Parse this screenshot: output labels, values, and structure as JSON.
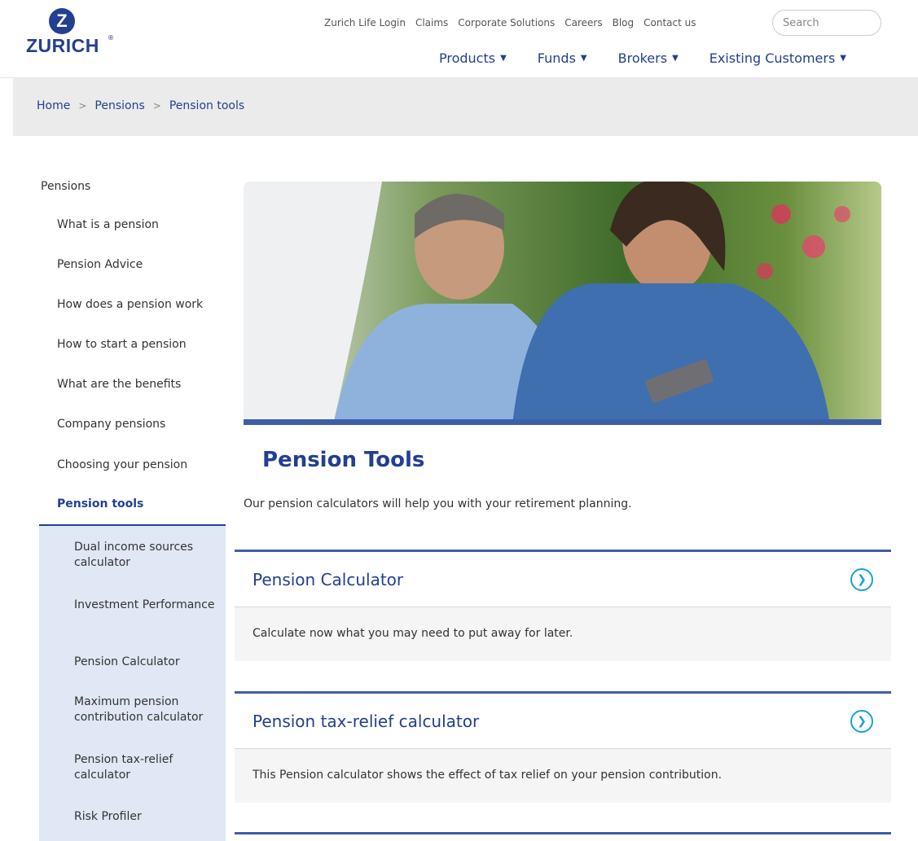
{
  "brand": {
    "logo_mark": "Z",
    "name": "ZURICH",
    "registered": "®"
  },
  "utility_nav": [
    "Zurich Life Login",
    "Claims",
    "Corporate Solutions",
    "Careers",
    "Blog",
    "Contact us"
  ],
  "search": {
    "placeholder": "Search"
  },
  "main_nav": [
    {
      "label": "Products"
    },
    {
      "label": "Funds"
    },
    {
      "label": "Brokers"
    },
    {
      "label": "Existing Customers"
    }
  ],
  "breadcrumb": [
    "Home",
    "Pensions",
    "Pension tools"
  ],
  "breadcrumb_separator": ">",
  "sidebar": {
    "root": "Pensions",
    "items": [
      "What is a pension",
      "Pension Advice",
      "How does a pension work",
      "How to start a pension",
      "What are the benefits",
      "Company pensions",
      "Choosing your pension"
    ],
    "active": "Pension tools",
    "sub_items": [
      "Dual income sources calculator",
      "Investment Performance",
      "Pension Calculator",
      "Maximum pension contribution calculator",
      "Pension tax-relief calculator",
      "Risk Profiler"
    ]
  },
  "main": {
    "title": "Pension Tools",
    "intro": "Our pension calculators will help you with your retirement planning.",
    "cards": [
      {
        "title": "Pension Calculator",
        "description": "Calculate now what you may need to put away for later."
      },
      {
        "title": "Pension tax-relief calculator",
        "description": "This Pension calculator shows the effect of tax relief on your pension contribution."
      }
    ]
  },
  "colors": {
    "brand_blue": "#233f8f",
    "accent_blue": "#3f5ea8",
    "arrow_cyan": "#1da0d8",
    "subnav_bg": "#dfe8f4"
  },
  "icons": {
    "card_arrow": "chevron-right-circle-icon",
    "nav_caret": "caret-down-icon"
  }
}
